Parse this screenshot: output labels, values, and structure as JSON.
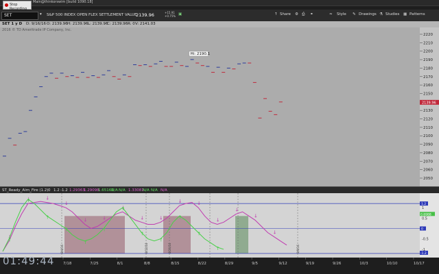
{
  "window": {
    "title": "Main@thinkorswim [build 1090.18]",
    "recording_label": "Stop Recording"
  },
  "toolbar": {
    "symbol": "SET",
    "description": "S&P 500 INDEX OPEN FLEX SETTLEMENT VALUE",
    "last": "2139.96",
    "change_top": "+15.91",
    "change_bottom": "+0.75%",
    "share": "Share",
    "style": "Style",
    "drawings": "Drawings",
    "studies": "Studies",
    "patterns": "Patterns"
  },
  "infobar": {
    "period": "SET 1 y D",
    "date": "D: 9/16/16",
    "open": "O: 2139.96",
    "high": "H: 2139.96",
    "low": "L: 2139.96",
    "close": "C: 2139.96",
    "range": "R: 0",
    "volume": "V: 2141.03"
  },
  "copyright": "2016 © TD Ameritrade IP Company, Inc.",
  "hi_label": "Hi: 2190.1",
  "clock": "01:49:44",
  "study_bar": {
    "name": "ST_Ready_Aim_Fire (1.2)",
    "values": [
      "0",
      "1.2",
      "-1.2",
      "1.29363",
      "1.29098",
      "1.65162",
      "N/A",
      "N/A",
      "1.33081",
      "N/A",
      "N/A",
      "N/A"
    ]
  },
  "price_axis": {
    "min": 2050,
    "max": 2220,
    "labels": [
      "2220",
      "2210",
      "2200",
      "2190",
      "2180",
      "2170",
      "2160",
      "2150",
      "2140",
      "2130",
      "2120",
      "2110",
      "2100",
      "2090",
      "2080",
      "2070",
      "2060",
      "2050"
    ]
  },
  "study_axis": {
    "labels": [
      "1",
      "0.5",
      "0",
      "-0.5",
      "-1"
    ],
    "badge_upper": "1.2",
    "badge_value": "0.6988",
    "badge_zero": "0",
    "badge_lower": "-1.2"
  },
  "date_axis": [
    "7/18",
    "7/25",
    "8/1",
    "8/8",
    "8/15",
    "8/22",
    "8/29",
    "9/5",
    "9/12",
    "9/19",
    "9/26",
    "10/3",
    "10/10",
    "10/17"
  ],
  "event_markers": [
    "8/4/16",
    "8/12/16",
    "8/26/16",
    "9/9/16"
  ],
  "colors": {
    "up_bar": "#2a3a9a",
    "down_bar": "#c0283a",
    "oscillator": "#c03ab0",
    "signal": "#48d048",
    "level_line": "#2e3ab8"
  },
  "chart_data": [
    {
      "type": "bar",
      "title": "SET",
      "ylim": [
        2050,
        2220
      ],
      "bars": [
        {
          "x": "7/1",
          "y": 2076,
          "dir": "up"
        },
        {
          "x": "7/5",
          "y": 2097,
          "dir": "up"
        },
        {
          "x": "7/6",
          "y": 2089,
          "dir": "down"
        },
        {
          "x": "7/7",
          "y": 2103,
          "dir": "up"
        },
        {
          "x": "7/8",
          "y": 2105,
          "dir": "up"
        },
        {
          "x": "7/11",
          "y": 2130,
          "dir": "up"
        },
        {
          "x": "7/12",
          "y": 2146,
          "dir": "up"
        },
        {
          "x": "7/13",
          "y": 2158,
          "dir": "up"
        },
        {
          "x": "7/14",
          "y": 2170,
          "dir": "up"
        },
        {
          "x": "7/15",
          "y": 2174,
          "dir": "up"
        },
        {
          "x": "7/18",
          "y": 2168,
          "dir": "down"
        },
        {
          "x": "7/19",
          "y": 2174,
          "dir": "up"
        },
        {
          "x": "7/20",
          "y": 2170,
          "dir": "down"
        },
        {
          "x": "7/21",
          "y": 2171,
          "dir": "up"
        },
        {
          "x": "7/22",
          "y": 2169,
          "dir": "down"
        },
        {
          "x": "7/25",
          "y": 2175,
          "dir": "up"
        },
        {
          "x": "7/26",
          "y": 2169,
          "dir": "down"
        },
        {
          "x": "7/27",
          "y": 2171,
          "dir": "up"
        },
        {
          "x": "7/28",
          "y": 2169,
          "dir": "down"
        },
        {
          "x": "7/29",
          "y": 2172,
          "dir": "up"
        },
        {
          "x": "8/1",
          "y": 2177,
          "dir": "up"
        },
        {
          "x": "8/2",
          "y": 2170,
          "dir": "down"
        },
        {
          "x": "8/3",
          "y": 2167,
          "dir": "down"
        },
        {
          "x": "8/4",
          "y": 2172,
          "dir": "up"
        },
        {
          "x": "8/5",
          "y": 2170,
          "dir": "down"
        },
        {
          "x": "8/8",
          "y": 2184,
          "dir": "up"
        },
        {
          "x": "8/9",
          "y": 2183,
          "dir": "down"
        },
        {
          "x": "8/10",
          "y": 2184,
          "dir": "up"
        },
        {
          "x": "8/11",
          "y": 2182,
          "dir": "down"
        },
        {
          "x": "8/12",
          "y": 2185,
          "dir": "up"
        },
        {
          "x": "8/15",
          "y": 2188,
          "dir": "up"
        },
        {
          "x": "8/16",
          "y": 2182,
          "dir": "down"
        },
        {
          "x": "8/17",
          "y": 2182,
          "dir": "down"
        },
        {
          "x": "8/18",
          "y": 2187,
          "dir": "up"
        },
        {
          "x": "8/19",
          "y": 2183,
          "dir": "down"
        },
        {
          "x": "8/22",
          "y": 2182,
          "dir": "up"
        },
        {
          "x": "8/23",
          "y": 2190.1,
          "dir": "up"
        },
        {
          "x": "8/24",
          "y": 2186,
          "dir": "down"
        },
        {
          "x": "8/25",
          "y": 2183,
          "dir": "down"
        },
        {
          "x": "8/26",
          "y": 2182,
          "dir": "up"
        },
        {
          "x": "8/29",
          "y": 2175,
          "dir": "down"
        },
        {
          "x": "8/30",
          "y": 2181,
          "dir": "up"
        },
        {
          "x": "8/31",
          "y": 2175,
          "dir": "down"
        },
        {
          "x": "9/1",
          "y": 2180,
          "dir": "up"
        },
        {
          "x": "9/2",
          "y": 2179,
          "dir": "down"
        },
        {
          "x": "9/6",
          "y": 2185,
          "dir": "up"
        },
        {
          "x": "9/7",
          "y": 2186,
          "dir": "up"
        },
        {
          "x": "9/8",
          "y": 2186,
          "dir": "down"
        },
        {
          "x": "9/9",
          "y": 2163,
          "dir": "down"
        },
        {
          "x": "9/12",
          "y": 2121,
          "dir": "down"
        },
        {
          "x": "9/13",
          "y": 2144,
          "dir": "down"
        },
        {
          "x": "9/14",
          "y": 2129,
          "dir": "down"
        },
        {
          "x": "9/15",
          "y": 2125,
          "dir": "down"
        },
        {
          "x": "9/16",
          "y": 2140,
          "dir": "down"
        }
      ]
    },
    {
      "type": "line",
      "title": "ST_Ready_Aim_Fire (1.2)",
      "ylim": [
        -1.2,
        1.5
      ],
      "series": [
        {
          "name": "oscillator",
          "values": [
            -1.1,
            -0.6,
            0.1,
            0.7,
            1.2,
            1.25,
            1.3,
            1.25,
            1.2,
            1.1,
            1.0,
            0.8,
            0.5,
            0.2,
            0.0,
            0.1,
            0.3,
            0.5,
            0.7,
            0.8,
            0.6,
            0.4,
            0.3,
            0.2,
            0.2,
            0.3,
            0.5,
            0.8,
            1.1,
            1.2,
            1.25,
            1.0,
            0.6,
            0.3,
            0.2,
            0.3,
            0.5,
            0.7,
            0.8,
            0.6,
            0.4,
            0.1,
            -0.2,
            -0.4,
            -0.6,
            -0.8
          ]
        },
        {
          "name": "signal",
          "values": [
            -1.1,
            -0.5,
            0.3,
            1.0,
            1.4,
            1.2,
            0.9,
            0.6,
            0.4,
            0.2,
            0.0,
            -0.3,
            -0.5,
            -0.6,
            -0.5,
            -0.3,
            0.0,
            0.4,
            0.8,
            1.0,
            0.6,
            0.2,
            -0.2,
            -0.5,
            -0.6,
            -0.5,
            -0.2,
            0.3,
            0.6,
            0.4,
            0.1,
            -0.2,
            -0.5,
            -0.7,
            -0.9,
            -1.0
          ]
        }
      ],
      "levels": [
        1.2,
        0,
        -1.2
      ]
    }
  ]
}
